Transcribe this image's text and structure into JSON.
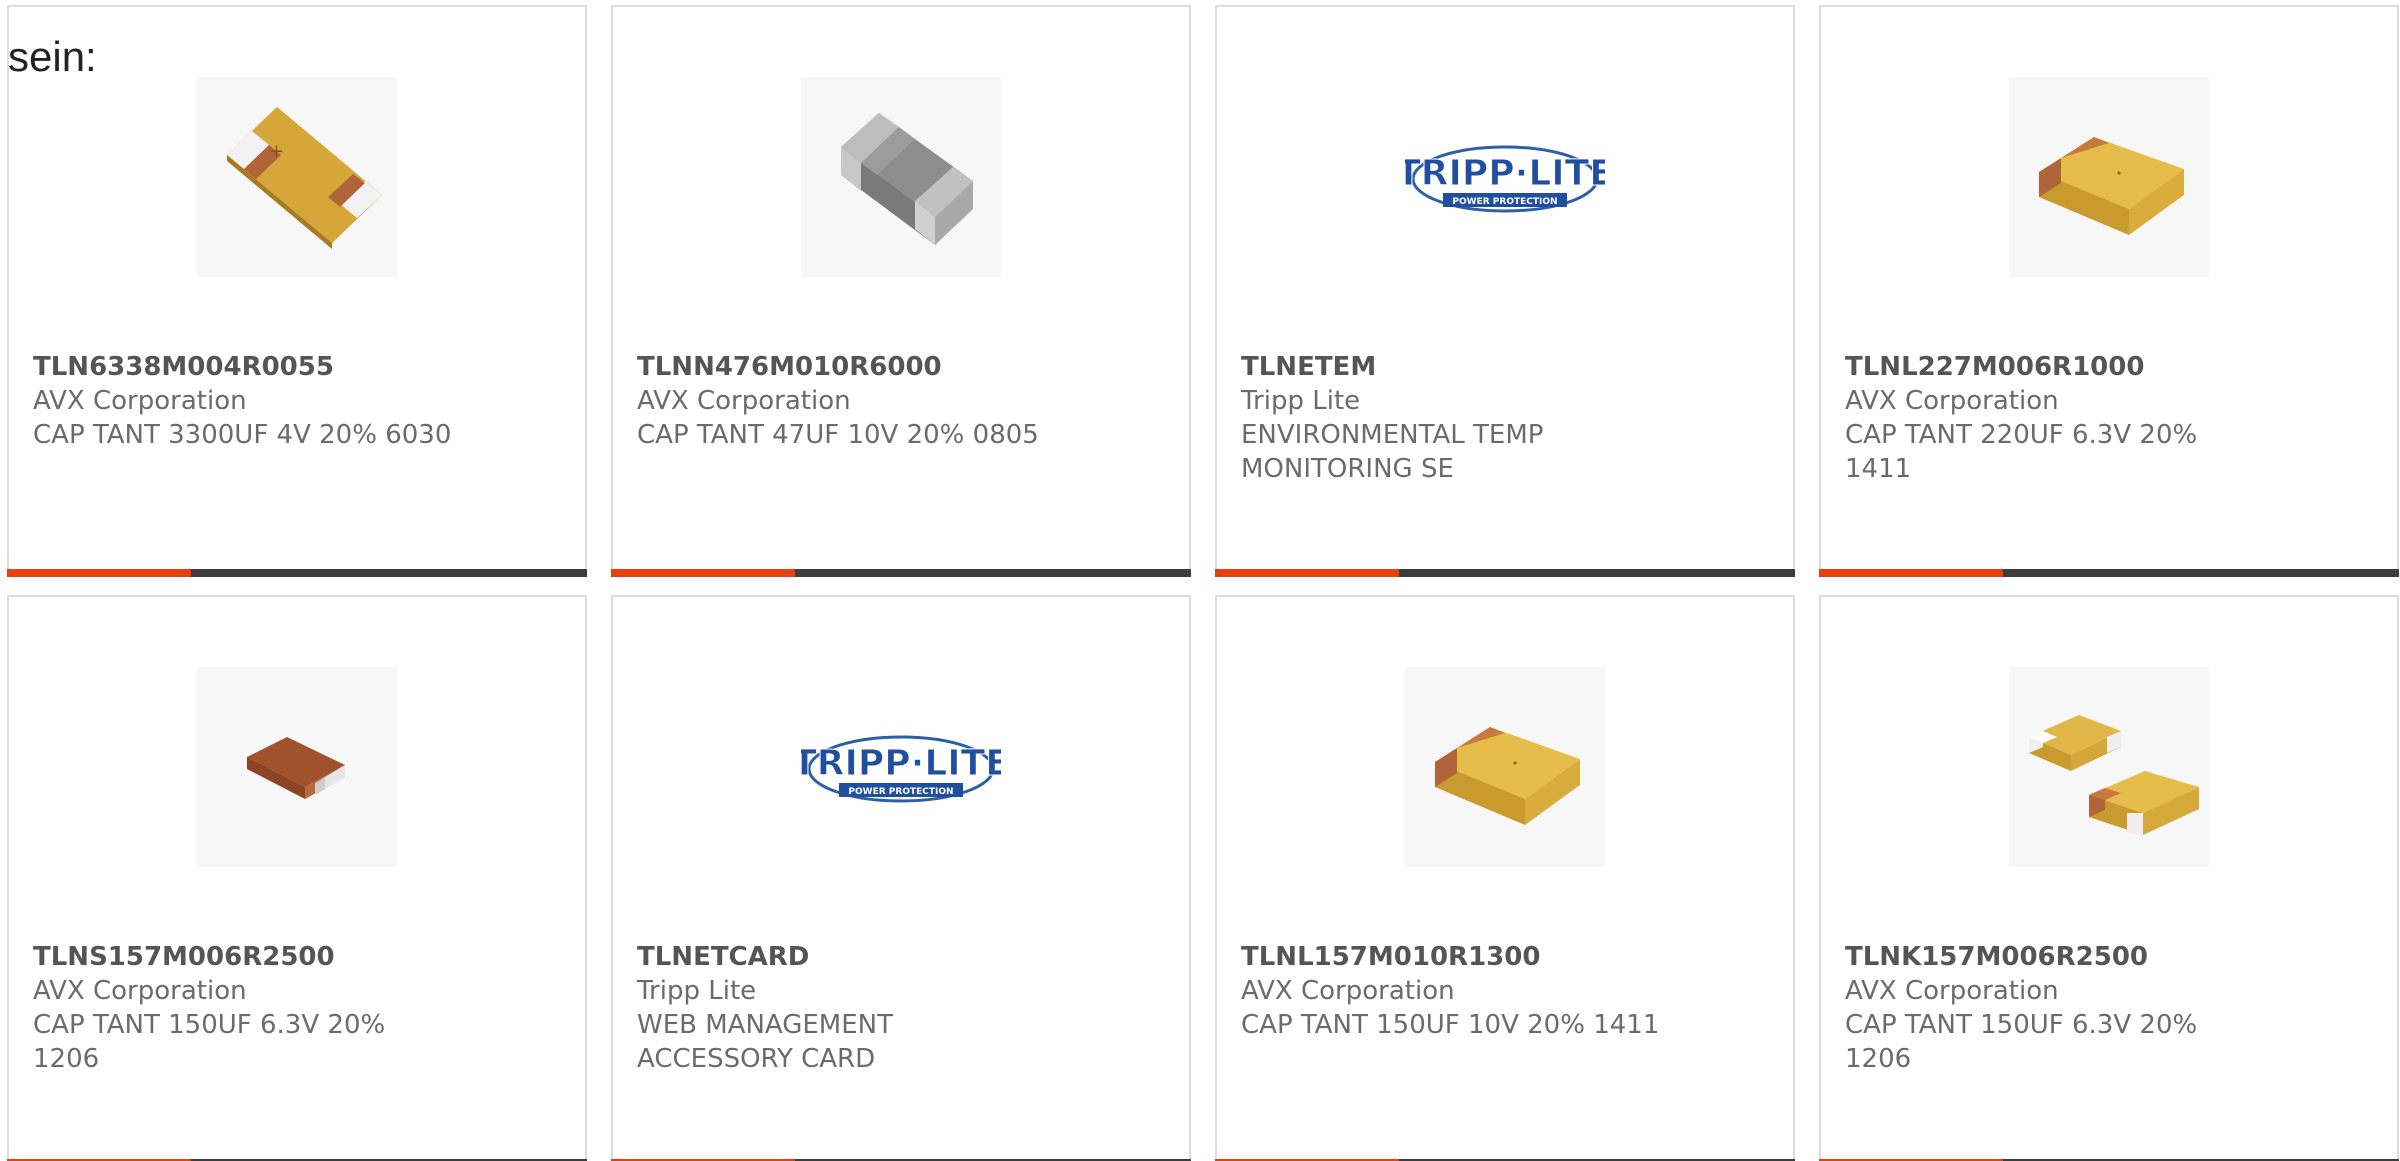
{
  "intro_text": "sein:",
  "accent_color": "#e8400c",
  "bar_color": "#3d3d3d",
  "products": [
    {
      "part_number": "TLN6338M004R0055",
      "manufacturer": "AVX Corporation",
      "description": "CAP TANT 3300UF 4V 20% 6030",
      "image": "tantalum-chip-large-icon"
    },
    {
      "part_number": "TLNN476M010R6000",
      "manufacturer": "AVX Corporation",
      "description": "CAP TANT 47UF 10V 20% 0805",
      "image": "ceramic-chip-icon"
    },
    {
      "part_number": "TLNETEM",
      "manufacturer": "Tripp Lite",
      "description": "ENVIRONMENTAL TEMP MONITORING SE",
      "image": "tripp-lite-logo",
      "logo_text": "TRIPP·LITE",
      "logo_subtext": "POWER PROTECTION"
    },
    {
      "part_number": "TLNL227M006R1000",
      "manufacturer": "AVX Corporation",
      "description": "CAP TANT 220UF 6.3V 20% 1411",
      "image": "tantalum-chip-block-icon"
    },
    {
      "part_number": "TLNS157M006R2500",
      "manufacturer": "AVX Corporation",
      "description": "CAP TANT 150UF 6.3V 20% 1206",
      "image": "tantalum-chip-small-icon"
    },
    {
      "part_number": "TLNETCARD",
      "manufacturer": "Tripp Lite",
      "description": "WEB MANAGEMENT ACCESSORY CARD",
      "image": "tripp-lite-logo",
      "logo_text": "TRIPP·LITE",
      "logo_subtext": "POWER PROTECTION"
    },
    {
      "part_number": "TLNL157M010R1300",
      "manufacturer": "AVX Corporation",
      "description": "CAP TANT 150UF 10V 20% 1411",
      "image": "tantalum-chip-block-icon"
    },
    {
      "part_number": "TLNK157M006R2500",
      "manufacturer": "AVX Corporation",
      "description": "CAP TANT 150UF 6.3V 20% 1206",
      "image": "tantalum-chip-pair-icon"
    }
  ]
}
